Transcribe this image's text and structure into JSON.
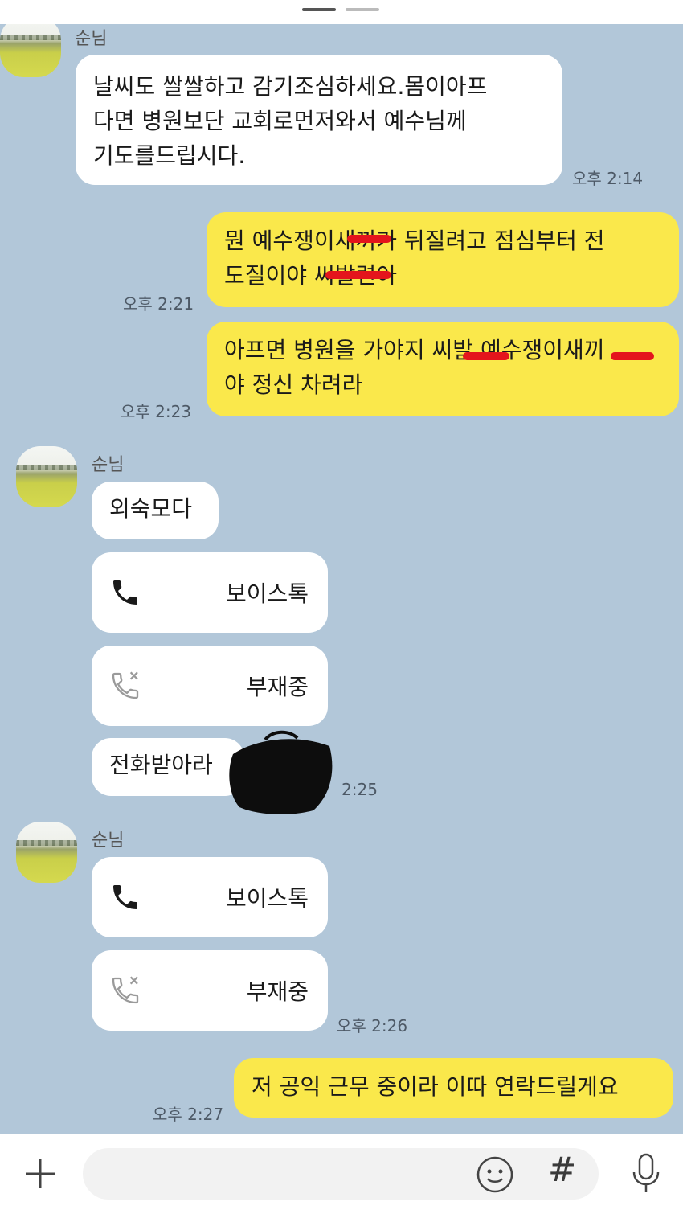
{
  "window": {
    "title": ""
  },
  "messages": [
    {
      "sender": "순님",
      "text": "날씨도 쌀쌀하고 감기조심하세요.몸이아프\n다면 병원보단 교회로먼저와서 예수님께\n기도를드립시다.",
      "time": "오후 2:14"
    },
    {
      "text": "뭔 예수쟁이새끼가 뒤질려고 점심부터 전\n도질이야 씨발련아",
      "time": "오후 2:21"
    },
    {
      "text": "아프면 병원을 가야지 씨발 예수쟁이새끼\n야 정신 차려라",
      "time": "오후 2:23"
    },
    {
      "sender": "순님",
      "text": "외숙모다"
    },
    {
      "call_label": "보이스톡",
      "icon": "phone-icon"
    },
    {
      "call_label": "부재중",
      "icon": "missed-call-icon"
    },
    {
      "text": "전화받아라",
      "time": "2:25"
    },
    {
      "sender": "순님",
      "call_label": "보이스톡",
      "icon": "phone-icon"
    },
    {
      "call_label": "부재중",
      "icon": "missed-call-icon",
      "time": "오후 2:26"
    },
    {
      "text": "저 공익 근무 중이라 이따 연락드릴게요",
      "time": "오후 2:27"
    }
  ],
  "input_bar": {
    "hash_label": "#",
    "icons": [
      "plus-icon",
      "emoji-icon",
      "hash-icon",
      "mic-icon"
    ]
  },
  "colors": {
    "chat_bg": "#b2c7d9",
    "outgoing": "#fae84b",
    "incoming": "#ffffff",
    "redaction": "#e4151c"
  }
}
